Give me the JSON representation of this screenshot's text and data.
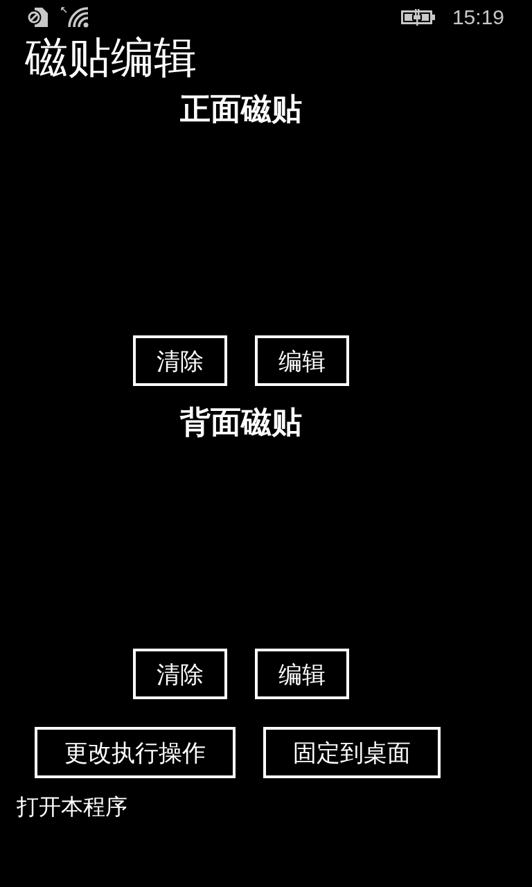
{
  "status_bar": {
    "time": "15:19"
  },
  "page_title": "磁贴编辑",
  "sections": [
    {
      "heading": "正面磁贴",
      "buttons": [
        "清除",
        "编辑"
      ]
    },
    {
      "heading": "背面磁贴",
      "buttons": [
        "清除",
        "编辑"
      ]
    }
  ],
  "action_buttons": [
    "更改执行操作",
    "固定到桌面"
  ],
  "current_action": "打开本程序"
}
